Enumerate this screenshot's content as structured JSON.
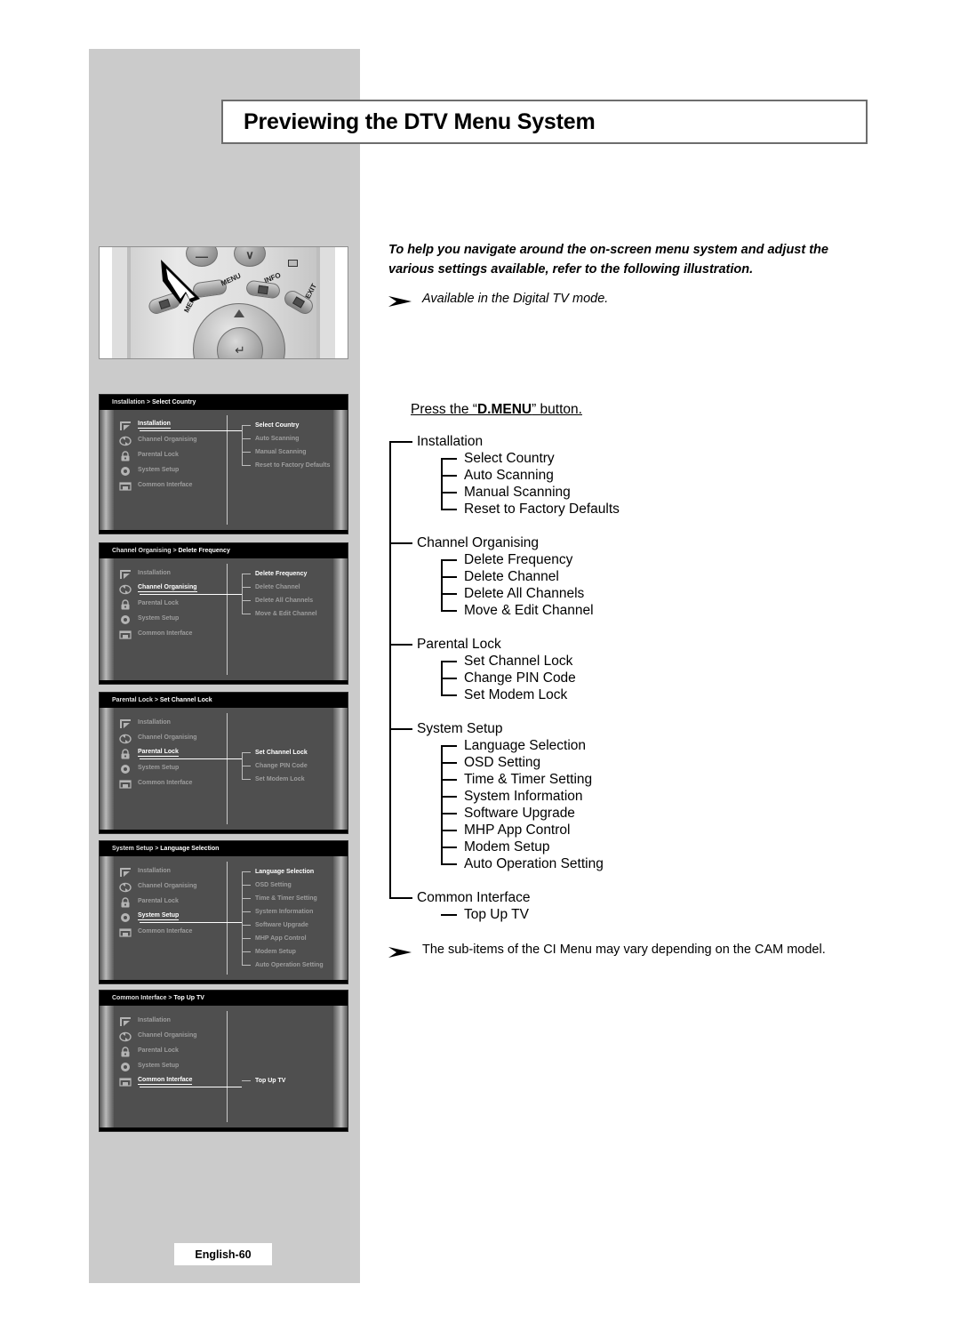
{
  "page": {
    "title": "Previewing the DTV Menu System",
    "footer_label": "English-60"
  },
  "intro": {
    "line1": "To help you navigate around the on-screen menu system and adjust the",
    "line2": "various settings available, refer to the following illustration.",
    "note_available": "Available in the Digital TV mode.",
    "note_ci": "The sub-items of the CI Menu may vary depending on the CAM model."
  },
  "press_instruction": {
    "before": "Press the “",
    "button": "D.MENU",
    "after": "” button."
  },
  "remote": {
    "labels": {
      "dmenu": "MENU",
      "menu": "MENU",
      "info": "INFO",
      "exit": "EXIT"
    },
    "minus_glyph": "—",
    "channel_glyph": "∨",
    "enter_glyph": "↵"
  },
  "menu_tree": [
    {
      "label": "Installation",
      "children": [
        "Select Country",
        "Auto Scanning",
        "Manual Scanning",
        "Reset to Factory Defaults"
      ]
    },
    {
      "label": "Channel Organising",
      "children": [
        "Delete Frequency",
        "Delete Channel",
        "Delete All Channels",
        "Move & Edit Channel"
      ]
    },
    {
      "label": "Parental Lock",
      "children": [
        "Set Channel Lock",
        "Change PIN Code",
        "Set Modem Lock"
      ]
    },
    {
      "label": "System Setup",
      "children": [
        "Language Selection",
        "OSD Setting",
        "Time & Timer Setting",
        "System Information",
        "Software Upgrade",
        "MHP App Control",
        "Modem Setup",
        "Auto Operation Setting"
      ]
    },
    {
      "label": "Common Interface",
      "children": [
        "Top Up TV"
      ]
    }
  ],
  "osd_main_items": [
    {
      "label": "Installation",
      "icon": "antenna-icon"
    },
    {
      "label": "Channel Organising",
      "icon": "refresh-icon"
    },
    {
      "label": "Parental Lock",
      "icon": "lock-icon"
    },
    {
      "label": "System Setup",
      "icon": "gear-icon"
    },
    {
      "label": "Common Interface",
      "icon": "card-slot-icon"
    }
  ],
  "osd_screens": [
    {
      "breadcrumb_parent": "Installation > ",
      "breadcrumb_current": "Select Country",
      "active_index": 0,
      "submenu": [
        "Select Country",
        "Auto Scanning",
        "Manual Scanning",
        "Reset to Factory Defaults"
      ]
    },
    {
      "breadcrumb_parent": "Channel Organising > ",
      "breadcrumb_current": "Delete Frequency",
      "active_index": 1,
      "submenu": [
        "Delete Frequency",
        "Delete Channel",
        "Delete All Channels",
        "Move & Edit Channel"
      ]
    },
    {
      "breadcrumb_parent": "Parental Lock > ",
      "breadcrumb_current": "Set Channel Lock",
      "active_index": 2,
      "submenu": [
        "Set Channel Lock",
        "Change PIN Code",
        "Set Modem Lock"
      ]
    },
    {
      "breadcrumb_parent": "System Setup > ",
      "breadcrumb_current": "Language Selection",
      "active_index": 3,
      "submenu": [
        "Language Selection",
        "OSD Setting",
        "Time & Timer Setting",
        "System Information",
        "Software Upgrade",
        "MHP App Control",
        "Modem Setup",
        "Auto Operation Setting"
      ]
    },
    {
      "breadcrumb_parent": "Common Interface > ",
      "breadcrumb_current": "Top Up TV",
      "active_index": 4,
      "submenu": [
        "Top Up TV"
      ]
    }
  ],
  "colors": {
    "sidebar_gray": "#cbcbcb",
    "osd_header": "#000000",
    "osd_body": "#4f4f4f",
    "osd_text_dim": "#9d9d9d",
    "osd_text_active": "#ffffff"
  }
}
